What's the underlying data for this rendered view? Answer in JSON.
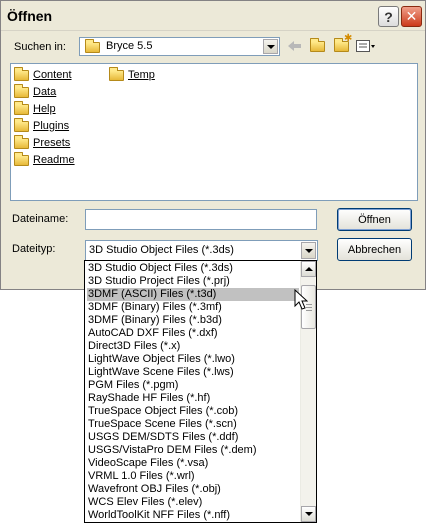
{
  "window": {
    "title": "Öffnen"
  },
  "look_in": {
    "label": "Suchen in:",
    "value": "Bryce 5.5"
  },
  "toolbar": {
    "icons": [
      "back-arrow-icon",
      "folder-up-icon",
      "new-folder-icon",
      "view-menu-icon"
    ]
  },
  "files": [
    {
      "name": "Content",
      "icon": "folder-icon"
    },
    {
      "name": "Data",
      "icon": "folder-icon"
    },
    {
      "name": "Help",
      "icon": "folder-icon"
    },
    {
      "name": "Plugins",
      "icon": "folder-icon"
    },
    {
      "name": "Presets",
      "icon": "folder-icon"
    },
    {
      "name": "Readme",
      "icon": "folder-icon"
    },
    {
      "name": "Temp",
      "icon": "folder-icon"
    }
  ],
  "filename": {
    "label": "Dateiname:",
    "value": ""
  },
  "filetype": {
    "label": "Dateityp:",
    "value": "3D Studio Object Files (*.3ds)"
  },
  "buttons": {
    "open": "Öffnen",
    "cancel": "Abbrechen"
  },
  "filetype_options": [
    "3D Studio Object Files (*.3ds)",
    "3D Studio Project Files (*.prj)",
    "3DMF (ASCII) Files (*.t3d)",
    "3DMF (Binary) Files (*.3mf)",
    "3DMF (Binary) Files (*.b3d)",
    "AutoCAD DXF Files (*.dxf)",
    "Direct3D Files (*.x)",
    "LightWave Object Files (*.lwo)",
    "LightWave Scene Files (*.lws)",
    "PGM Files (*.pgm)",
    "RayShade HF Files (*.hf)",
    "TrueSpace Object Files (*.cob)",
    "TrueSpace Scene Files (*.scn)",
    "USGS DEM/SDTS Files (*.ddf)",
    "USGS/VistaPro DEM Files (*.dem)",
    "VideoScape Files (*.vsa)",
    "VRML 1.0 Files (*.wrl)",
    "Wavefront OBJ Files (*.obj)",
    "WCS Elev Files (*.elev)",
    "WorldToolKit NFF Files (*.nff)"
  ],
  "highlighted_option": "3DMF (ASCII) Files (*.t3d)"
}
